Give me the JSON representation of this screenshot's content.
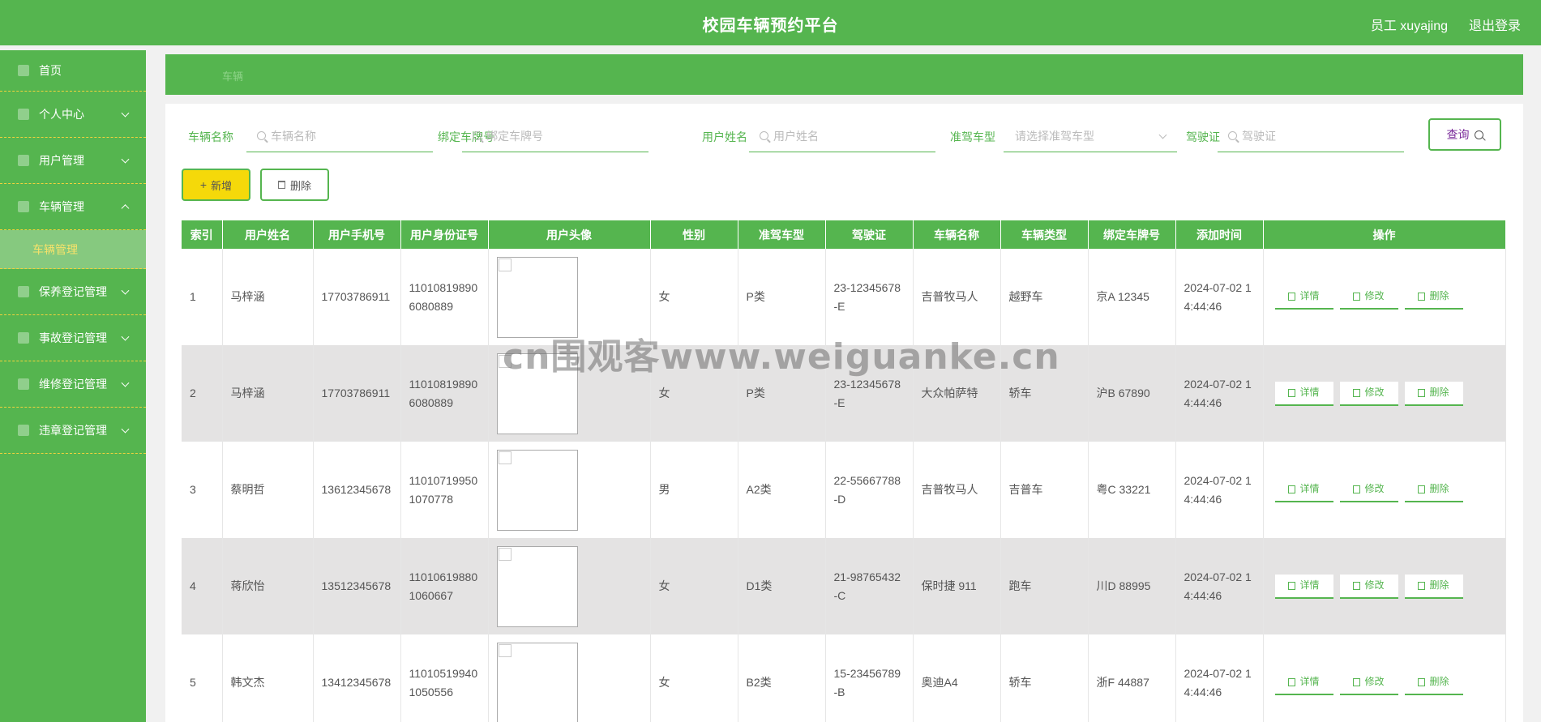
{
  "header": {
    "title": "校园车辆预约平台",
    "user": "员工 xuyajing",
    "logout": "退出登录"
  },
  "sidebar": {
    "items": [
      {
        "label": "首页",
        "icon": "home-icon",
        "expandable": false
      },
      {
        "label": "个人中心",
        "icon": "user-icon",
        "expandable": true
      },
      {
        "label": "用户管理",
        "icon": "users-icon",
        "expandable": true
      },
      {
        "label": "车辆管理",
        "icon": "car-icon",
        "expandable": true,
        "expanded": true,
        "children": [
          {
            "label": "车辆管理"
          }
        ]
      },
      {
        "label": "保养登记管理",
        "icon": "maintenance-icon",
        "expandable": true
      },
      {
        "label": "事故登记管理",
        "icon": "accident-icon",
        "expandable": true
      },
      {
        "label": "维修登记管理",
        "icon": "repair-icon",
        "expandable": true
      },
      {
        "label": "违章登记管理",
        "icon": "violation-icon",
        "expandable": true
      }
    ]
  },
  "breadcrumb": {
    "current": "车辆"
  },
  "search": {
    "vehicle_name": {
      "label": "车辆名称",
      "placeholder": "车辆名称"
    },
    "plate": {
      "label": "绑定车牌号",
      "placeholder": "绑定车牌号"
    },
    "user_name": {
      "label": "用户姓名",
      "placeholder": "用户姓名"
    },
    "license_type": {
      "label": "准驾车型",
      "placeholder": "请选择准驾车型"
    },
    "license": {
      "label": "驾驶证",
      "placeholder": "驾驶证"
    },
    "query": "查询"
  },
  "actions": {
    "add": "新增",
    "delete": "删除"
  },
  "table": {
    "headers": [
      "索引",
      "用户姓名",
      "用户手机号",
      "用户身份证号",
      "用户头像",
      "性别",
      "准驾车型",
      "驾驶证",
      "车辆名称",
      "车辆类型",
      "绑定车牌号",
      "添加时间",
      "操作"
    ],
    "op_labels": {
      "detail": "详情",
      "edit": "修改",
      "delete": "删除"
    },
    "rows": [
      {
        "index": "1",
        "name": "马梓涵",
        "phone": "17703786911",
        "id_card": "110108198906080889",
        "gender": "女",
        "license_type": "P类",
        "license": "23-12345678-E",
        "vehicle_name": "吉普牧马人",
        "vehicle_type": "越野车",
        "plate": "京A 12345",
        "added": "2024-07-02 14:44:46"
      },
      {
        "index": "2",
        "name": "马梓涵",
        "phone": "17703786911",
        "id_card": "110108198906080889",
        "gender": "女",
        "license_type": "P类",
        "license": "23-12345678-E",
        "vehicle_name": "大众帕萨特",
        "vehicle_type": "轿车",
        "plate": "沪B 67890",
        "added": "2024-07-02 14:44:46"
      },
      {
        "index": "3",
        "name": "蔡明哲",
        "phone": "13612345678",
        "id_card": "110107199501070778",
        "gender": "男",
        "license_type": "A2类",
        "license": "22-55667788-D",
        "vehicle_name": "吉普牧马人",
        "vehicle_type": "吉普车",
        "plate": "粤C 33221",
        "added": "2024-07-02 14:44:46"
      },
      {
        "index": "4",
        "name": "蒋欣怡",
        "phone": "13512345678",
        "id_card": "110106198801060667",
        "gender": "女",
        "license_type": "D1类",
        "license": "21-98765432-C",
        "vehicle_name": "保时捷 911",
        "vehicle_type": "跑车",
        "plate": "川D 88995",
        "added": "2024-07-02 14:44:46"
      },
      {
        "index": "5",
        "name": "韩文杰",
        "phone": "13412345678",
        "id_card": "110105199401050556",
        "gender": "女",
        "license_type": "B2类",
        "license": "15-23456789-B",
        "vehicle_name": "奥迪A4",
        "vehicle_type": "轿车",
        "plate": "浙F 44887",
        "added": "2024-07-02 14:44:46"
      }
    ]
  },
  "watermark": "cn围观客www.weiguanke.cn"
}
